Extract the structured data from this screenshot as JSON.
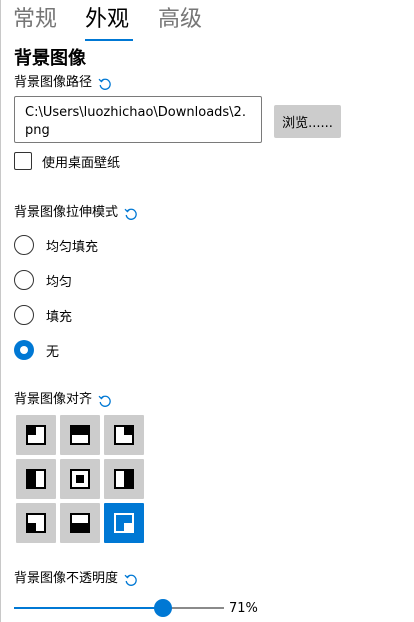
{
  "tabs": [
    {
      "label": "常规",
      "active": false
    },
    {
      "label": "外观",
      "active": true
    },
    {
      "label": "高级",
      "active": false
    }
  ],
  "section": {
    "title": "背景图像"
  },
  "path": {
    "label": "背景图像路径",
    "value": "C:\\Users\\luozhichao\\Downloads\\2.png",
    "browse_label": "浏览......"
  },
  "desktop_wallpaper": {
    "label": "使用桌面壁纸",
    "checked": false
  },
  "stretch_mode": {
    "label": "背景图像拉伸模式",
    "options": [
      {
        "label": "均匀填充",
        "checked": false
      },
      {
        "label": "均匀",
        "checked": false
      },
      {
        "label": "填充",
        "checked": false
      },
      {
        "label": "无",
        "checked": true
      }
    ]
  },
  "alignment": {
    "label": "背景图像对齐",
    "cells": [
      {
        "name": "top-left",
        "selected": false
      },
      {
        "name": "top",
        "selected": false
      },
      {
        "name": "top-right",
        "selected": false
      },
      {
        "name": "left",
        "selected": false
      },
      {
        "name": "center",
        "selected": false
      },
      {
        "name": "right",
        "selected": false
      },
      {
        "name": "bottom-left",
        "selected": false
      },
      {
        "name": "bottom",
        "selected": false
      },
      {
        "name": "bottom-right",
        "selected": true
      }
    ]
  },
  "opacity": {
    "label": "背景图像不透明度",
    "value": 71,
    "value_text": "71%"
  },
  "colors": {
    "accent": "#0078d4",
    "button_bg": "#cccccc",
    "inactive_tab": "#767676"
  },
  "icons": {
    "reset": "reset-icon"
  }
}
